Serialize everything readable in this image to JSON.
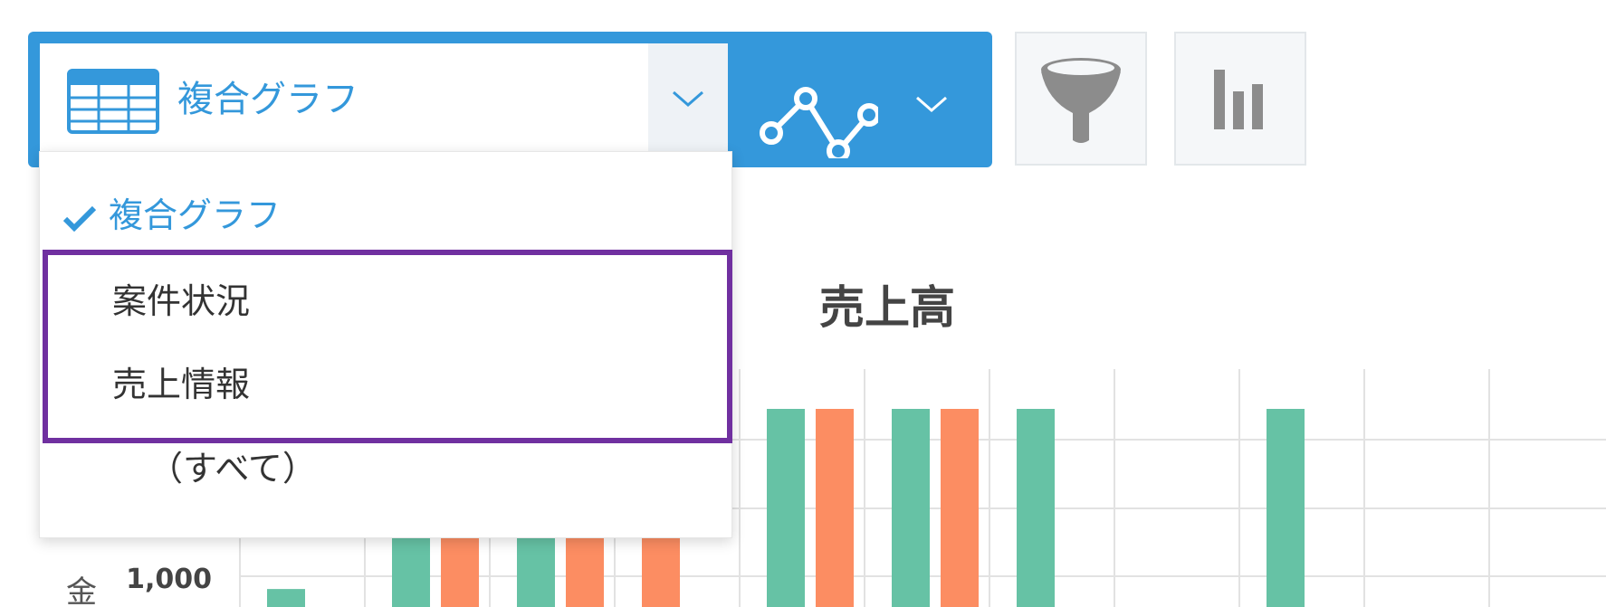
{
  "toolbar": {
    "view_selector": {
      "current": "複合グラフ"
    },
    "icons": {
      "view_type": "table-icon",
      "graph_type": "line-graph-icon",
      "filter": "filter-icon",
      "chart_settings": "bar-chart-icon"
    },
    "colors": {
      "accent": "#3498db",
      "icon_gray": "#8c8c8c"
    }
  },
  "dropdown": {
    "items": [
      {
        "label": "複合グラフ",
        "selected": true
      },
      {
        "label": "案件状況",
        "selected": false
      },
      {
        "label": "売上情報",
        "selected": false
      },
      {
        "label": "（すべて）",
        "selected": false
      }
    ],
    "highlight_color": "#7030a0"
  },
  "chart": {
    "title": "売上高",
    "y_tick_label": "1,000",
    "y_axis_label_fragment": "金"
  },
  "chart_data": {
    "type": "bar",
    "title": "売上高",
    "series": [
      {
        "color": "#66c2a5",
        "values": [
          1000,
          1350,
          1350,
          null,
          1800,
          1800,
          1800,
          null,
          1800
        ]
      },
      {
        "color": "#fc8d62",
        "values": [
          null,
          1350,
          1350,
          1800,
          1800,
          1800,
          null,
          null,
          null
        ]
      }
    ],
    "ylim": [
      0,
      1800
    ],
    "y_ticks": [
      1000
    ],
    "grid": true
  }
}
